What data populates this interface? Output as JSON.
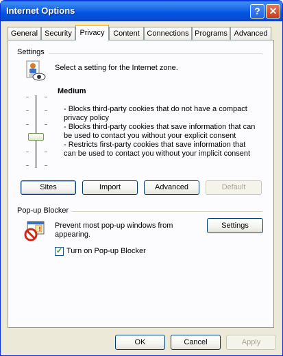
{
  "window": {
    "title": "Internet Options"
  },
  "title_buttons": {
    "help": "?",
    "close": "✕"
  },
  "tabs": [
    {
      "label": "General"
    },
    {
      "label": "Security"
    },
    {
      "label": "Privacy"
    },
    {
      "label": "Content"
    },
    {
      "label": "Connections"
    },
    {
      "label": "Programs"
    },
    {
      "label": "Advanced"
    }
  ],
  "active_tab": "Privacy",
  "settings": {
    "group_label": "Settings",
    "description": "Select a setting for the Internet zone.",
    "level_title": "Medium",
    "bullets": [
      "- Blocks third-party cookies that do not have a compact",
      "privacy policy",
      "- Blocks third-party cookies that save information that can",
      "be used to contact you without your explicit consent",
      "- Restricts first-party cookies that save information that",
      "can be used to contact you without your implicit consent"
    ],
    "buttons": {
      "sites": "Sites",
      "import": "Import",
      "advanced": "Advanced",
      "default": "Default"
    }
  },
  "popup": {
    "group_label": "Pop-up Blocker",
    "description_line1": "Prevent most pop-up windows from",
    "description_line2": "appearing.",
    "settings_button": "Settings",
    "checkbox_label": "Turn on Pop-up Blocker",
    "checkbox_checked": true
  },
  "footer": {
    "ok": "OK",
    "cancel": "Cancel",
    "apply": "Apply"
  }
}
